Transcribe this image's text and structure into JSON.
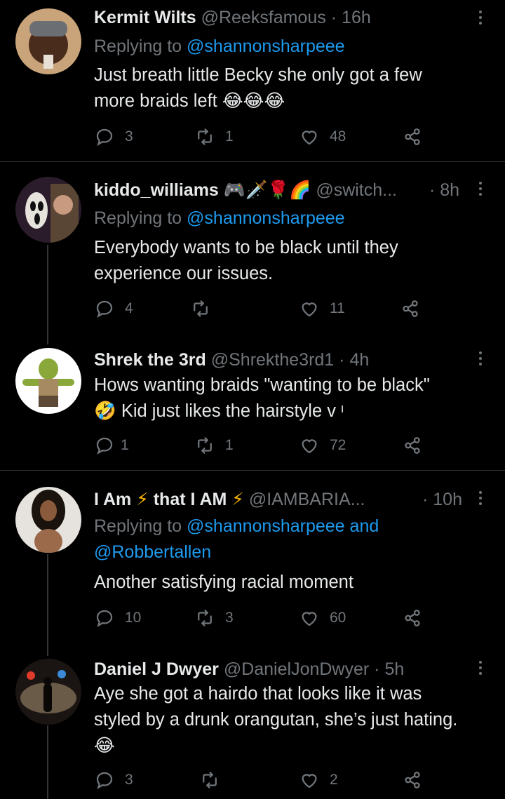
{
  "tweets": [
    {
      "name": "Kermit Wilts",
      "handle": "@Reeksfamous",
      "time": "· 16h",
      "replying_prefix": "Replying to ",
      "replying_to": "@shannonsharpeee",
      "text": "Just breath little Becky she only got a few more braids left",
      "emoji": [
        "😂",
        "😂",
        "😂"
      ],
      "replies": "3",
      "retweets": "1",
      "likes": "48"
    },
    {
      "name": "kiddo_williams",
      "name_emoji": [
        "🎮",
        "🗡️",
        "🌹",
        "🌈"
      ],
      "handle": "@switch...",
      "time": "· 8h",
      "replying_prefix": "Replying to ",
      "replying_to": "@shannonsharpeee",
      "text": "Everybody wants to be black until they experience our issues.",
      "replies": "4",
      "retweets": "",
      "likes": "11"
    },
    {
      "name": "Shrek the 3rd",
      "handle": "@Shrekthe3rd1",
      "time": "· 4h",
      "text_line1": "Hows wanting braids \"wanting to be black\"",
      "text_emoji": "🤣",
      "text_line2": "Kid just likes the hairstyle v  ᶦ",
      "replies": "1",
      "retweets": "1",
      "likes": "72"
    },
    {
      "name_part1": "I Am",
      "name_part2": "that I AM",
      "name_emoji": "⚡",
      "handle": "@IAMBARIA...",
      "time": "· 10h",
      "replying_prefix": "Replying to ",
      "replying_to": "@shannonsharpeee",
      "replying_and": " and",
      "replying_to2": "@Robbertallen",
      "text": "Another satisfying racial moment",
      "replies": "10",
      "retweets": "3",
      "likes": "60"
    },
    {
      "name": "Daniel J Dwyer",
      "handle": "@DanielJonDwyer",
      "time": "· 5h",
      "text": "Aye she got a hairdo that looks like it was styled by a drunk orangutan, she’s just hating.",
      "emoji": "😂",
      "replies": "3",
      "retweets": "",
      "likes": "2"
    }
  ],
  "colors": {
    "background": "#000000",
    "text": "#e7e9ea",
    "muted": "#71767b",
    "link": "#1d9bf0",
    "divider": "#2f3336"
  },
  "icons": [
    "more-icon",
    "reply-icon",
    "retweet-icon",
    "like-icon",
    "share-icon"
  ]
}
